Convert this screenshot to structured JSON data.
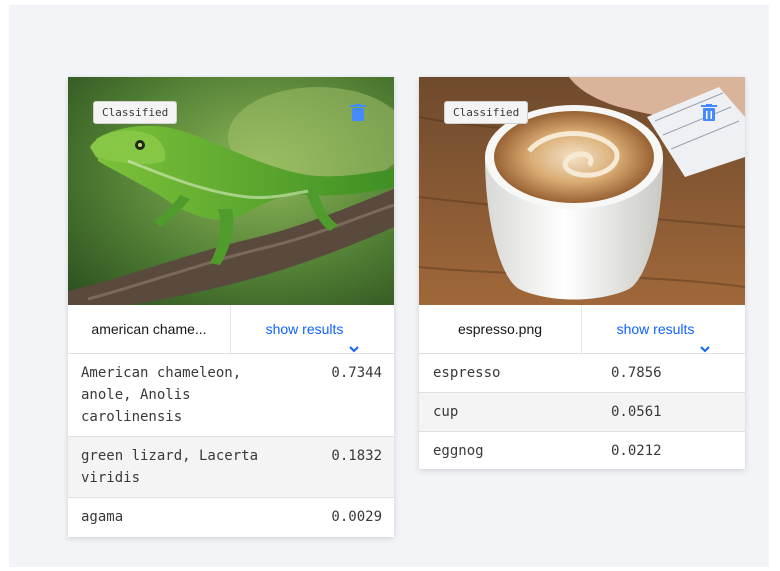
{
  "cards": [
    {
      "tag": "Classified",
      "filename": "american chame...",
      "show_results": "show results",
      "results": [
        {
          "label": "American chameleon, anole, Anolis carolinensis",
          "score": "0.7344"
        },
        {
          "label": "green lizard, Lacerta viridis",
          "score": "0.1832"
        },
        {
          "label": "agama",
          "score": "0.0029"
        }
      ]
    },
    {
      "tag": "Classified",
      "filename": "espresso.png",
      "show_results": "show results",
      "results": [
        {
          "label": "espresso",
          "score": "0.7856"
        },
        {
          "label": "cup",
          "score": "0.0561"
        },
        {
          "label": "eggnog",
          "score": "0.0212"
        }
      ]
    }
  ],
  "colors": {
    "accent": "#0f62fe",
    "background": "#f2f4f8",
    "card": "#ffffff"
  },
  "icons": {
    "delete": "trash-icon",
    "expand": "chevron-down-icon"
  }
}
